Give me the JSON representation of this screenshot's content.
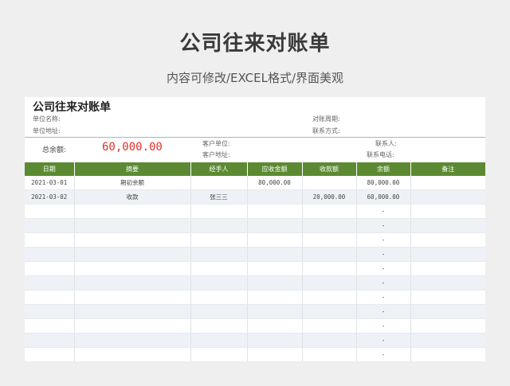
{
  "header": {
    "title": "公司往来对账单",
    "subtitle": "内容可修改/EXCEL格式/界面美观"
  },
  "sheet": {
    "title": "公司往来对账单",
    "unit_name_label": "单位名称:",
    "unit_address_label": "单位地址:",
    "period_label": "对账周期:",
    "contact_method_label": "联系方式:",
    "total_label": "总余额:",
    "total_value": "60,000.00",
    "customer_unit_label": "客户单位:",
    "customer_address_label": "客户地址:",
    "contact_person_label": "联系人:",
    "contact_phone_label": "联系电话:"
  },
  "table": {
    "headers": [
      "日期",
      "摘要",
      "经手人",
      "应收金额",
      "收款额",
      "余额",
      "备注"
    ],
    "rows": [
      [
        "2021-03-01",
        "期初余额",
        "",
        "80,000.00",
        "",
        "80,000.00",
        ""
      ],
      [
        "2021-03-02",
        "收款",
        "张三三",
        "",
        "20,000.00",
        "60,000.00",
        ""
      ],
      [
        "",
        "",
        "",
        "",
        "",
        "-",
        ""
      ],
      [
        "",
        "",
        "",
        "",
        "",
        "-",
        ""
      ],
      [
        "",
        "",
        "",
        "",
        "",
        "-",
        ""
      ],
      [
        "",
        "",
        "",
        "",
        "",
        "-",
        ""
      ],
      [
        "",
        "",
        "",
        "",
        "",
        "-",
        ""
      ],
      [
        "",
        "",
        "",
        "",
        "",
        "-",
        ""
      ],
      [
        "",
        "",
        "",
        "",
        "",
        "-",
        ""
      ],
      [
        "",
        "",
        "",
        "",
        "",
        "-",
        ""
      ],
      [
        "",
        "",
        "",
        "",
        "",
        "-",
        ""
      ],
      [
        "",
        "",
        "",
        "",
        "",
        "-",
        ""
      ],
      [
        "",
        "",
        "",
        "",
        "",
        "-",
        ""
      ],
      [
        "",
        "",
        "",
        "",
        "",
        "-",
        ""
      ]
    ]
  },
  "colors": {
    "header_green": "#5b8a32",
    "total_red": "#e0302a",
    "row_alt": "#eef1f6"
  }
}
